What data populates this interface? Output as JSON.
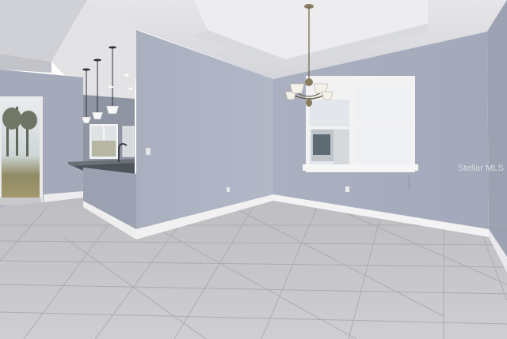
{
  "photo": {
    "watermark": "Stellar MLS"
  },
  "colors": {
    "wall_light": "#adb3c3",
    "wall_dark": "#9ba1b1",
    "ceiling": "#eaeaec",
    "floor": "#c7c7cb",
    "baseboard": "#f4f4f4",
    "window_sky": "#eef0f4",
    "lawn": "#8a7d5a"
  }
}
